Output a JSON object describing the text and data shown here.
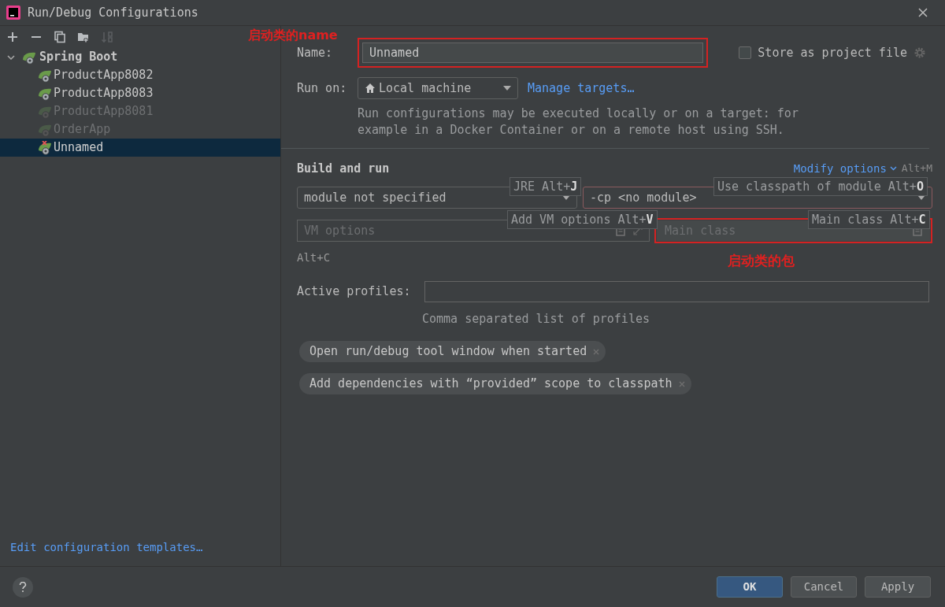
{
  "window": {
    "title": "Run/Debug Configurations"
  },
  "toolbar": [
    {
      "kind": "add",
      "disabled": false
    },
    {
      "kind": "remove",
      "disabled": false
    },
    {
      "kind": "copy",
      "disabled": false
    },
    {
      "kind": "folder",
      "disabled": false
    },
    {
      "kind": "sort",
      "disabled": true
    }
  ],
  "tree": {
    "label": "Spring Boot",
    "expanded": true,
    "children": [
      {
        "label": "ProductApp8082",
        "disabled": false,
        "error": false,
        "selected": false
      },
      {
        "label": "ProductApp8083",
        "disabled": false,
        "error": false,
        "selected": false
      },
      {
        "label": "ProductApp8081",
        "disabled": true,
        "error": false,
        "selected": false
      },
      {
        "label": "OrderApp",
        "disabled": true,
        "error": false,
        "selected": false
      },
      {
        "label": "Unnamed",
        "disabled": false,
        "error": true,
        "selected": true
      }
    ]
  },
  "edit_templates_link": "Edit configuration templates…",
  "form": {
    "name_label": "Name:",
    "name_value": "Unnamed",
    "store": {
      "label": "Store as project file",
      "checked": false
    },
    "run_on_label": "Run on:",
    "target": "Local machine",
    "manage_link": "Manage targets…",
    "run_on_hint": [
      "Run configurations may be executed locally or on a target: for",
      "example in a Docker Container or on a remote host using SSH."
    ]
  },
  "build": {
    "title": "Build and run",
    "modify_options": "Modify options",
    "modify_shortcut": "Alt+M",
    "jre": "module not specified",
    "classpath": "-cp <no module>",
    "vm_placeholder": "VM options",
    "main_class_placeholder": "Main class",
    "shortcut_note": "Alt+C",
    "hints": [
      "JRE Alt+**J**",
      "Use classpath of module Alt+**O**",
      "Add VM options Alt+**V**",
      "Main class Alt+**C**"
    ]
  },
  "profiles": {
    "label": "Active profiles:",
    "hint": "Comma separated list of profiles"
  },
  "options": [
    "Open run/debug tool window when started",
    "Add dependencies with “provided” scope to classpath"
  ],
  "annotations": [
    "启动类的name",
    "启动类的包"
  ],
  "buttons": [
    {
      "label": "OK",
      "primary": true
    },
    {
      "label": "Cancel",
      "primary": false
    },
    {
      "label": "Apply",
      "primary": false
    }
  ]
}
